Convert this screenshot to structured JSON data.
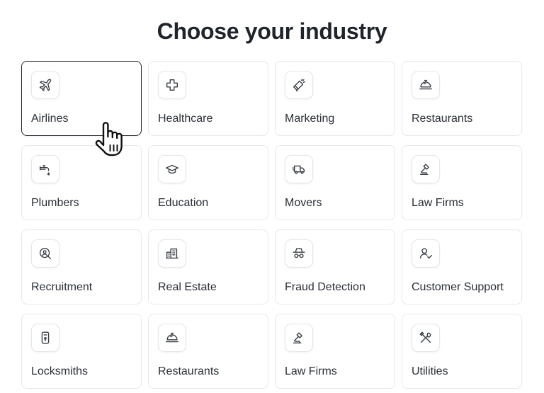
{
  "heading": "Choose your industry",
  "industries": [
    {
      "label": "Airlines",
      "icon": "plane-icon",
      "selected": true
    },
    {
      "label": "Healthcare",
      "icon": "medical-cross-icon"
    },
    {
      "label": "Marketing",
      "icon": "megaphone-icon"
    },
    {
      "label": "Restaurants",
      "icon": "cloche-icon"
    },
    {
      "label": "Plumbers",
      "icon": "faucet-icon"
    },
    {
      "label": "Education",
      "icon": "graduation-cap-icon"
    },
    {
      "label": "Movers",
      "icon": "moving-truck-icon"
    },
    {
      "label": "Law Firms",
      "icon": "gavel-icon"
    },
    {
      "label": "Recruitment",
      "icon": "search-person-icon"
    },
    {
      "label": "Real Estate",
      "icon": "buildings-icon"
    },
    {
      "label": "Fraud Detection",
      "icon": "spy-icon"
    },
    {
      "label": "Customer Support",
      "icon": "user-check-icon"
    },
    {
      "label": "Locksmiths",
      "icon": "door-lock-icon"
    },
    {
      "label": "Restaurants",
      "icon": "cloche-icon"
    },
    {
      "label": "Law Firms",
      "icon": "gavel-icon"
    },
    {
      "label": "Utilities",
      "icon": "tools-icon"
    }
  ],
  "colors": {
    "selected_border": "#262a31",
    "card_border": "#e6e8ec",
    "icon_stroke": "#3a3f47",
    "text": "#2a2f37"
  },
  "cursor": "hand-pointer-icon"
}
